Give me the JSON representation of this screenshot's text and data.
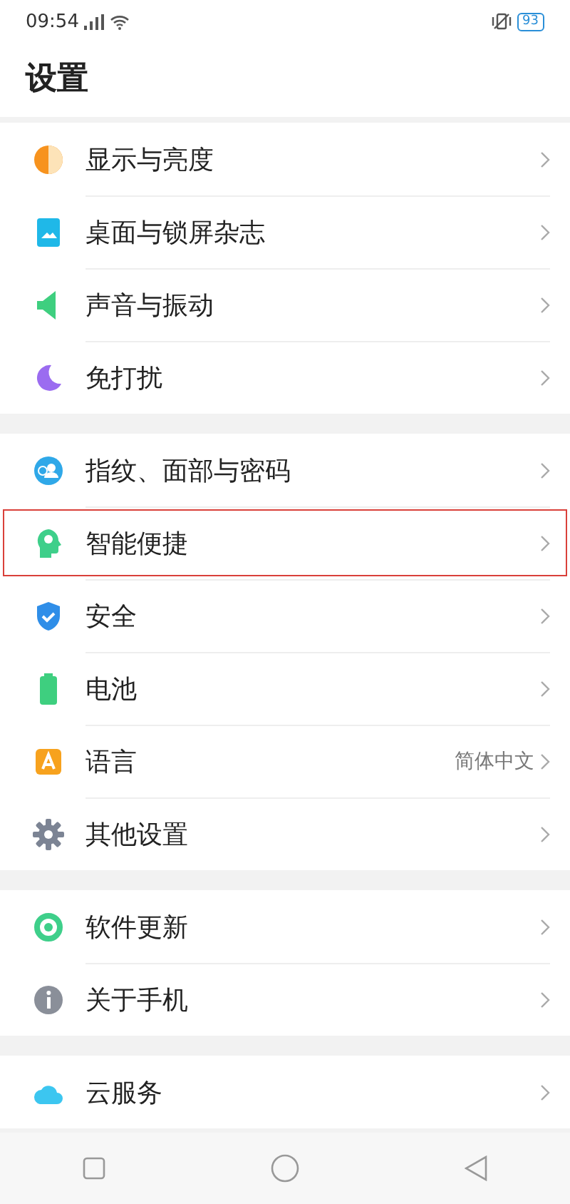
{
  "status_bar": {
    "time": "09:54",
    "battery": "93"
  },
  "title": "设置",
  "groups": [
    {
      "items": [
        {
          "kind": "display",
          "label": "显示与亮度",
          "highlighted": false
        },
        {
          "kind": "wallpaper",
          "label": "桌面与锁屏杂志",
          "highlighted": false
        },
        {
          "kind": "sound",
          "label": "声音与振动",
          "highlighted": false
        },
        {
          "kind": "dnd",
          "label": "免打扰",
          "highlighted": false
        }
      ]
    },
    {
      "items": [
        {
          "kind": "biometrics",
          "label": "指纹、面部与密码",
          "highlighted": false
        },
        {
          "kind": "assistant",
          "label": "智能便捷",
          "highlighted": true
        },
        {
          "kind": "security",
          "label": "安全",
          "highlighted": false
        },
        {
          "kind": "battery",
          "label": "电池",
          "highlighted": false
        },
        {
          "kind": "language",
          "label": "语言",
          "value": "简体中文",
          "highlighted": false
        },
        {
          "kind": "settings",
          "label": "其他设置",
          "highlighted": false
        }
      ]
    },
    {
      "items": [
        {
          "kind": "update",
          "label": "软件更新",
          "highlighted": false
        },
        {
          "kind": "about",
          "label": "关于手机",
          "highlighted": false
        }
      ]
    },
    {
      "items": [
        {
          "kind": "cloud",
          "label": "云服务",
          "highlighted": false
        }
      ]
    }
  ]
}
